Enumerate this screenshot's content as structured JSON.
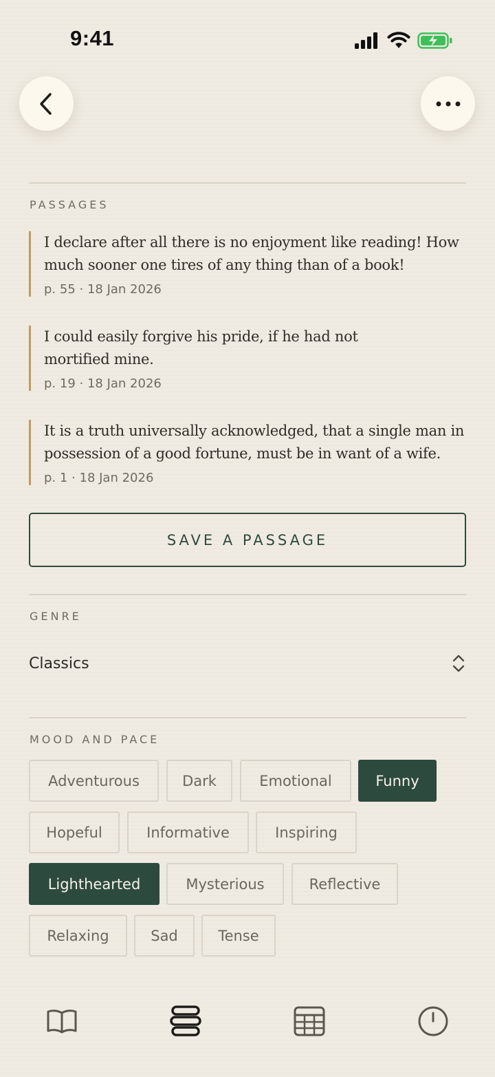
{
  "status_bar": {
    "time": "9:41"
  },
  "sections": {
    "passages_label": "PASSAGES",
    "genre_label": "GENRE",
    "mood_label": "MOOD AND PACE"
  },
  "passages": [
    {
      "text": "I declare after all there is no enjoyment like reading! How much sooner one tires of any thing than of a book!",
      "meta": "p. 55 · 18 Jan 2026"
    },
    {
      "text": "I could easily forgive his pride, if he had not mortified mine.",
      "meta": "p. 19 · 18 Jan 2026"
    },
    {
      "text": "It is a truth universally acknowledged, that a single man in possession of a good fortune, must be in want of a wife.",
      "meta": "p. 1 · 18 Jan 2026"
    }
  ],
  "save_button": "SAVE A PASSAGE",
  "genre": {
    "value": "Classics"
  },
  "mood_tags": [
    {
      "label": "Adventurous",
      "selected": false
    },
    {
      "label": "Dark",
      "selected": false
    },
    {
      "label": "Emotional",
      "selected": false
    },
    {
      "label": "Funny",
      "selected": true
    },
    {
      "label": "Hopeful",
      "selected": false
    },
    {
      "label": "Informative",
      "selected": false
    },
    {
      "label": "Inspiring",
      "selected": false
    },
    {
      "label": "Lighthearted",
      "selected": true
    },
    {
      "label": "Mysterious",
      "selected": false
    },
    {
      "label": "Reflective",
      "selected": false
    },
    {
      "label": "Relaxing",
      "selected": false
    },
    {
      "label": "Sad",
      "selected": false
    },
    {
      "label": "Tense",
      "selected": false
    }
  ],
  "tab_bar": [
    "book-icon",
    "stack-icon",
    "calendar-grid-icon",
    "clock-icon"
  ],
  "colors": {
    "accent": "#2d4a3e",
    "quote_border": "#c39a5a",
    "background": "#f0ebe2",
    "battery": "#3fbf5a"
  }
}
